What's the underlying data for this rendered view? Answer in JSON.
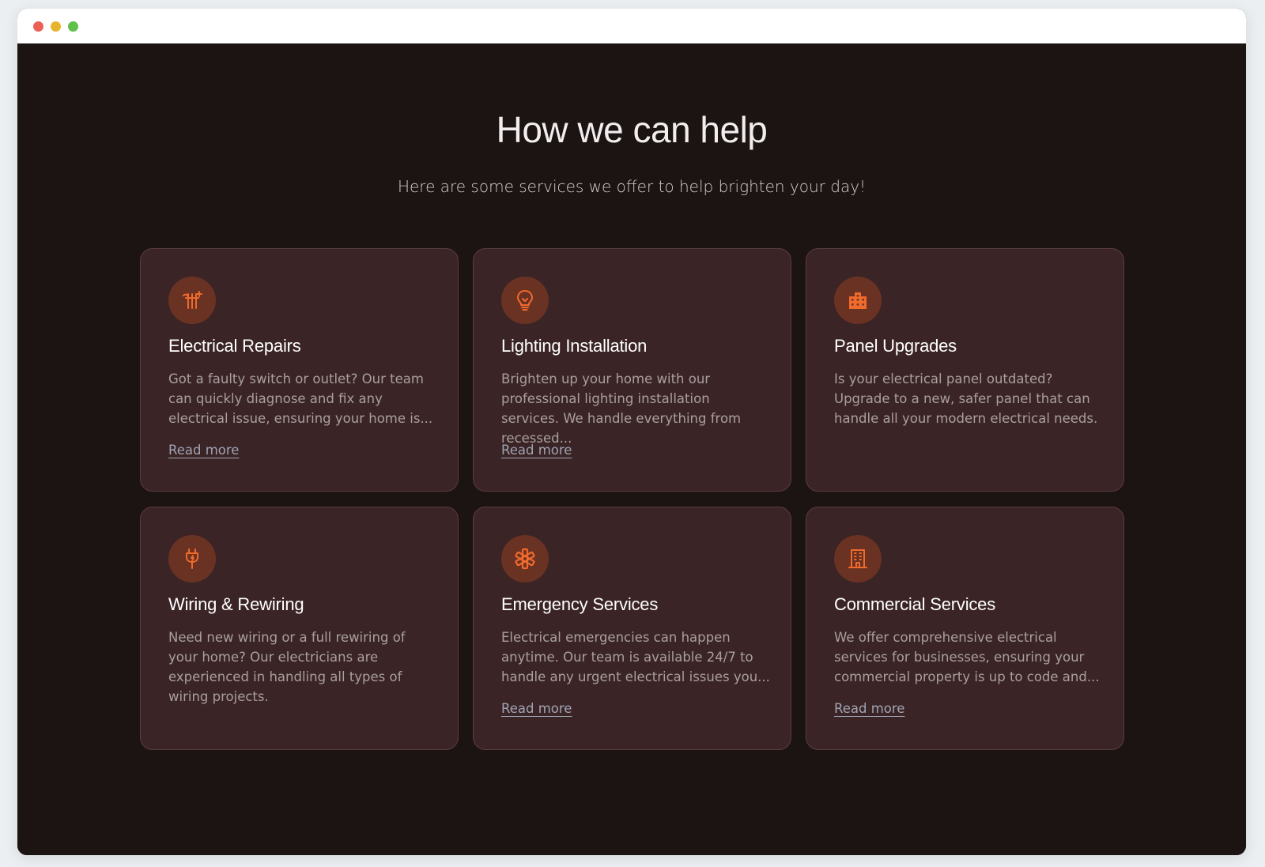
{
  "window": {
    "buttons": [
      {
        "name": "close",
        "color": "#ec5f57"
      },
      {
        "name": "minimize",
        "color": "#e8b42c"
      },
      {
        "name": "maximize",
        "color": "#5fc04b"
      }
    ]
  },
  "section": {
    "title": "How we can help",
    "subtitle": "Here are some services we offer to help brighten your day!"
  },
  "colors": {
    "background": "#1c1313",
    "card": "#3b2426",
    "accent": "#f06a2c",
    "icon_bg": "#6a3223",
    "link": "#9fa4b2"
  },
  "services": [
    {
      "icon": "electrical-tools-icon",
      "title": "Electrical Repairs",
      "description": "Got a faulty switch or outlet? Our team can quickly diagnose and fix any electrical issue, ensuring your home is...",
      "link": "Read more"
    },
    {
      "icon": "lightbulb-icon",
      "title": "Lighting Installation",
      "description": "Brighten up your home with our professional lighting installation services. We handle everything from recessed...",
      "link": "Read more"
    },
    {
      "icon": "building-blocks-icon",
      "title": "Panel Upgrades",
      "description": "Is your electrical panel outdated? Upgrade to a new, safer panel that can handle all your modern electrical needs.",
      "link": ""
    },
    {
      "icon": "plug-icon",
      "title": "Wiring & Rewiring",
      "description": "Need new wiring or a full rewiring of your home? Our electricians are experienced in handling all types of wiring projects.",
      "link": ""
    },
    {
      "icon": "asterisk-icon",
      "title": "Emergency Services",
      "description": "Electrical emergencies can happen anytime. Our team is available 24/7 to handle any urgent electrical issues you...",
      "link": "Read more"
    },
    {
      "icon": "office-building-icon",
      "title": "Commercial Services",
      "description": "We offer comprehensive electrical services for businesses, ensuring your commercial property is up to code and...",
      "link": "Read more"
    }
  ]
}
